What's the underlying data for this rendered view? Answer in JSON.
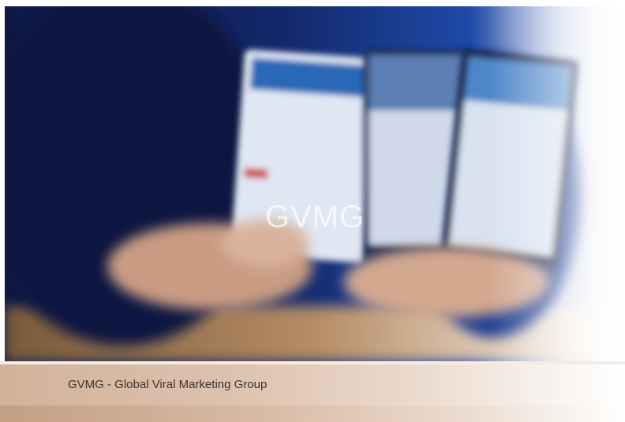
{
  "hero": {
    "title": "GVMG"
  },
  "caption": {
    "text": "GVMG - Global Viral Marketing Group"
  },
  "colors": {
    "hero_background": "#0f1e4e",
    "caption_background": "#d3b29a",
    "caption_text": "#3a3431"
  }
}
